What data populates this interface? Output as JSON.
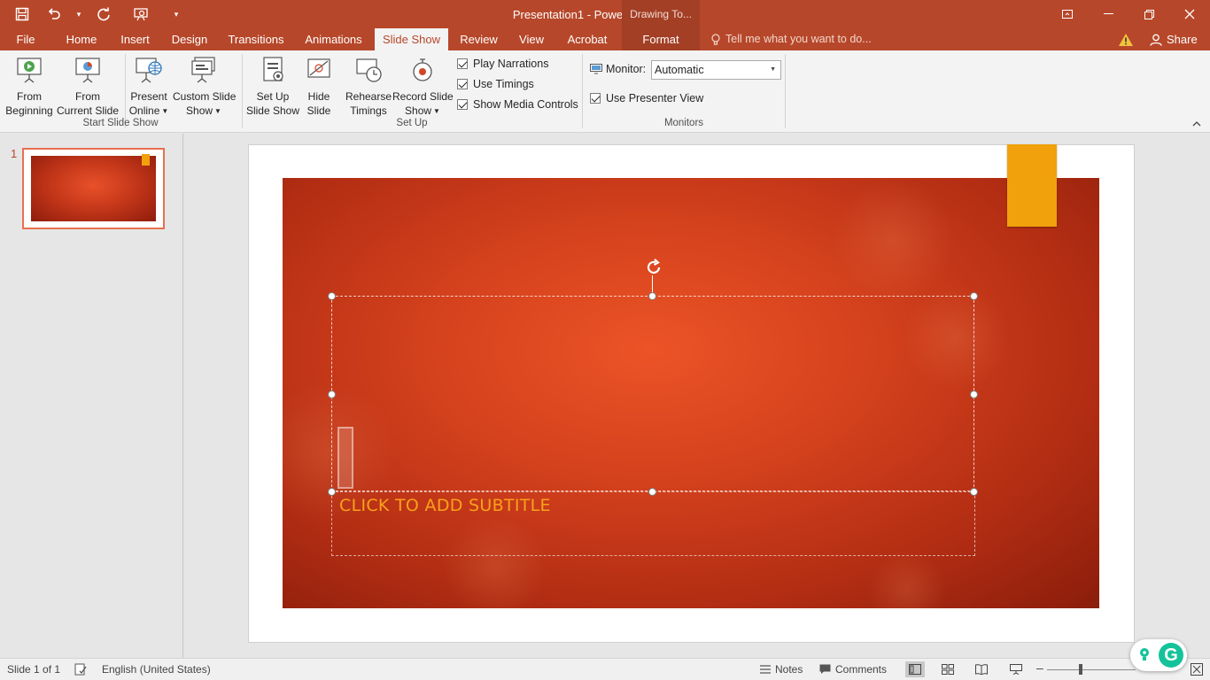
{
  "window": {
    "title": "Presentation1 - PowerPoint",
    "context_tab_group": "Drawing To..."
  },
  "qat": {
    "save_icon": "save-icon",
    "undo_icon": "undo-icon",
    "redo_icon": "repeat-icon",
    "present_icon": "present-icon",
    "customize_icon": "customize-icon"
  },
  "tabs": [
    "File",
    "Home",
    "Insert",
    "Design",
    "Transitions",
    "Animations",
    "Slide Show",
    "Review",
    "View",
    "Acrobat",
    "Format"
  ],
  "active_tab": "Slide Show",
  "tell_me": "Tell me what you want to do...",
  "share": "Share",
  "ribbon": {
    "start": {
      "label": "Start Slide Show",
      "from_beginning": [
        "From",
        "Beginning"
      ],
      "from_current": [
        "From",
        "Current Slide"
      ],
      "present_online": [
        "Present",
        "Online"
      ],
      "custom_show": [
        "Custom Slide",
        "Show"
      ]
    },
    "setup": {
      "label": "Set Up",
      "setup_show": [
        "Set Up",
        "Slide Show"
      ],
      "hide_slide": [
        "Hide",
        "Slide"
      ],
      "rehearse": [
        "Rehearse",
        "Timings"
      ],
      "record": [
        "Record Slide",
        "Show"
      ],
      "play_narrations": "Play Narrations",
      "use_timings": "Use Timings",
      "show_media_controls": "Show Media Controls"
    },
    "monitors": {
      "label": "Monitors",
      "monitor_label": "Monitor:",
      "monitor_value": "Automatic",
      "presenter_view": "Use Presenter View"
    }
  },
  "thumbnails": [
    {
      "number": "1"
    }
  ],
  "slide": {
    "subtitle_placeholder": "CLICK TO ADD SUBTITLE",
    "accent_color": "#f1a10c"
  },
  "status": {
    "slide_of": "Slide 1 of 1",
    "language": "English (United States)",
    "notes": "Notes",
    "comments": "Comments"
  },
  "colors": {
    "brand": "#b7472a",
    "subtitle": "#f7a21b"
  }
}
